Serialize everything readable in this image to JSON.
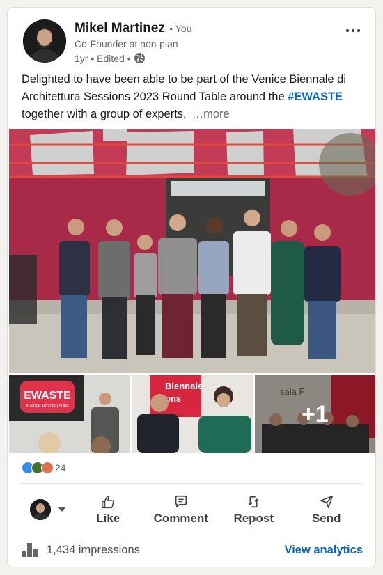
{
  "author": {
    "name": "Mikel Martinez",
    "relation": "• You",
    "headline": "Co-Founder at non-plan",
    "meta": "1yr • Edited •"
  },
  "post": {
    "text_part1": "Delighted to have been able to be part of the Venice Biennale di Architettura Sessions 2023 Round Table around the ",
    "hashtag": "#EWASTE",
    "text_part2": " together with a group of experts,",
    "see_more": "…more"
  },
  "media": {
    "thumb1_sign": "EWASTE",
    "thumb1_sub": "BURDEN AND TREASURE",
    "thumb2_sign": "Biennale\nssions",
    "thumb3_sign": "sala F",
    "more_count": "+1"
  },
  "reactions": {
    "count": "24"
  },
  "actions": {
    "like": "Like",
    "comment": "Comment",
    "repost": "Repost",
    "send": "Send"
  },
  "footer": {
    "impressions": "1,434 impressions",
    "analytics": "View analytics"
  },
  "colors": {
    "brand_blue": "#0a66c2",
    "pavilion_red": "#b52f4e"
  }
}
